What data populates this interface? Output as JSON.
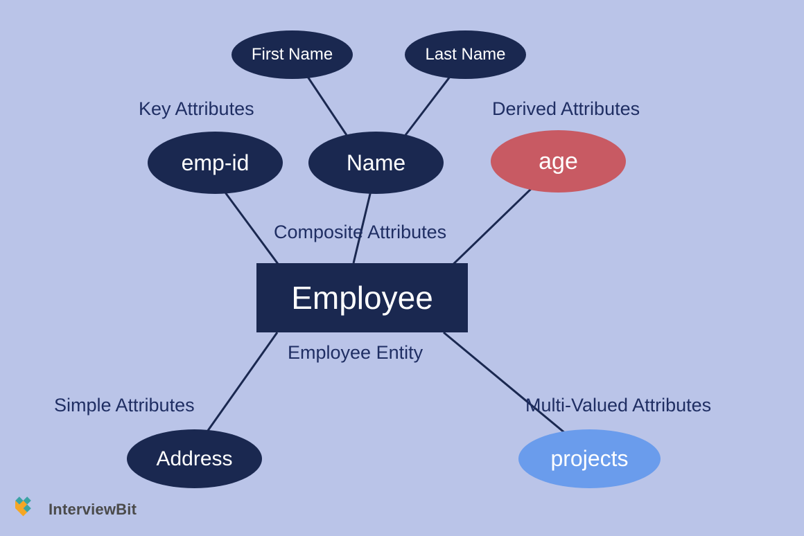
{
  "entity": {
    "label": "Employee",
    "caption": "Employee Entity"
  },
  "attributes": {
    "emp_id": {
      "label": "emp-id",
      "group_label": "Key Attributes"
    },
    "name": {
      "label": "Name",
      "group_label": "Composite Attributes"
    },
    "first_name": {
      "label": "First Name"
    },
    "last_name": {
      "label": "Last Name"
    },
    "age": {
      "label": "age",
      "group_label": "Derived Attributes"
    },
    "address": {
      "label": "Address",
      "group_label": "Simple Attributes"
    },
    "projects": {
      "label": "projects",
      "group_label": "Multi-Valued Attributes"
    }
  },
  "brand": {
    "name": "InterviewBit"
  },
  "colors": {
    "bg": "#bac4e8",
    "node_dark": "#1a2850",
    "node_red": "#c85a63",
    "node_blue": "#6a9cec",
    "label": "#1f2e63"
  }
}
